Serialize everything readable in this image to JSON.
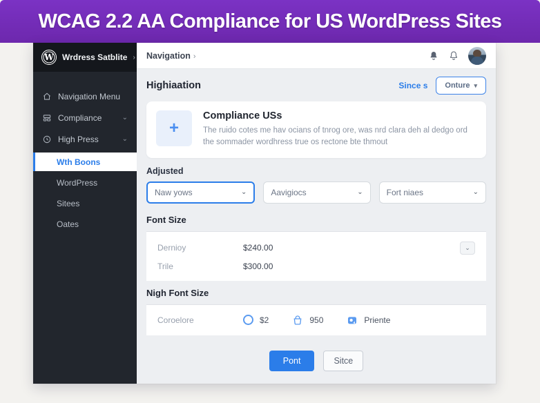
{
  "banner": {
    "title": "WCAG 2.2 AA Compliance for US WordPress Sites"
  },
  "sidebar": {
    "logo_text": "Wrdress Satblite",
    "logo_arrow": "›",
    "items": [
      {
        "label": "Navigation Menu",
        "icon": "home-icon"
      },
      {
        "label": "Compliance",
        "icon": "grid-icon",
        "chevron": "⌄"
      },
      {
        "label": "High Press",
        "icon": "clock-icon",
        "chevron": "⌄"
      }
    ],
    "subitems": [
      {
        "label": "Wth Boons",
        "active": true
      },
      {
        "label": "WordPress"
      },
      {
        "label": "Sitees"
      },
      {
        "label": "Oates"
      }
    ]
  },
  "topbar": {
    "breadcrumb": "Navigation",
    "breadcrumb_arrow": "›"
  },
  "page": {
    "title": "Highiaation",
    "link_label": "Since s",
    "filter_button": "Onture",
    "filter_chevron": "▾",
    "card": {
      "icon": "plus-icon",
      "plus_glyph": "+",
      "title": "Compliance USs",
      "description": "The ruido cotes me hav ocians of tnrog ore, was nrd clara deh al dedgo ord the sommader wordhress true os rectone bte thmout"
    },
    "adjusted_label": "Adjusted",
    "dropdowns": [
      {
        "value": "Naw yows",
        "focused": true
      },
      {
        "value": "Aavigiocs"
      },
      {
        "value": "Fort niaes"
      }
    ],
    "dropdown_chevron": "⌄",
    "font_size": {
      "title": "Font Size",
      "rows": [
        {
          "label": "Dernioy",
          "value": "$240.00"
        },
        {
          "label": "Trile",
          "value": "$300.00"
        }
      ],
      "row_chevron": "⌄"
    },
    "nigh_font_size": {
      "title": "Nigh Font Size",
      "row_label": "Coroelore",
      "stats": [
        {
          "icon": "radio-circle-icon",
          "value": "$2"
        },
        {
          "icon": "bag-icon",
          "value": "950"
        },
        {
          "icon": "image-icon",
          "value": "Priente"
        }
      ]
    },
    "actions": {
      "primary": "Pont",
      "secondary": "Sitce"
    }
  },
  "colors": {
    "banner_purple": "#7b32c4",
    "accent_blue": "#2b7de9",
    "sidebar_dark": "#22262d",
    "content_bg": "#edeff2"
  }
}
